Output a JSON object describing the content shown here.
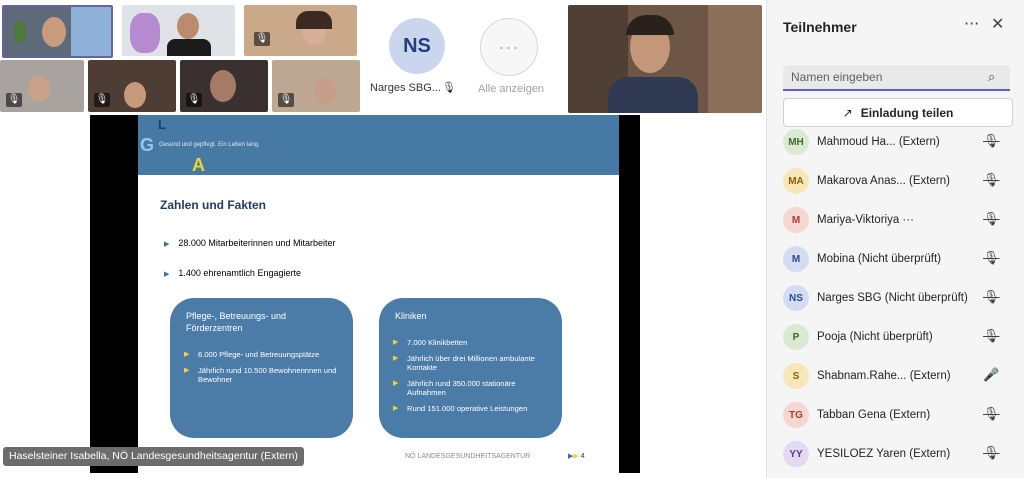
{
  "call": {
    "placeholder_avatar": {
      "initials": "NS",
      "name": "Narges SBG..."
    },
    "show_all_label": "Alle anzeigen",
    "presenter_name": "Haselsteiner Isabella, NÖ Landesgesundheitsagentur (Extern)"
  },
  "slide": {
    "logo_letters": {
      "l": "L",
      "g": "G",
      "a": "A"
    },
    "tagline": "Gesund und gepflegt. Ein Leben lang.",
    "title": "Zahlen und Fakten",
    "bullets": [
      "28.000 Mitarbeiterinnen und Mitarbeiter",
      "1.400 ehrenamtlich Engagierte"
    ],
    "box_left": {
      "title": "Pflege-, Betreuungs- und Förderzentren",
      "items": [
        "6.000 Pflege- und Betreuungsplätze",
        "Jährlich rund 10.500 Bewohnerinnen und Bewohner"
      ]
    },
    "box_right": {
      "title": "Kliniken",
      "items": [
        "7.000 Klinikbetten",
        "Jährlich über drei Millionen ambulante Kontakte",
        "Jährlich rund 350.000 stationäre Aufnahmen",
        "Rund 151.000 operative Leistungen"
      ]
    },
    "footer": "NÖ LANDESGESUNDHEITSAGENTUR",
    "page_number": "4"
  },
  "panel": {
    "title": "Teilnehmer",
    "search_placeholder": "Namen eingeben",
    "invite_label": "Einladung teilen",
    "participants": [
      {
        "initials": "MH",
        "name": "Mahmoud Ha...  (Extern)",
        "bg": "#dbe8d2",
        "fg": "#3f6a2a",
        "mic": "muted"
      },
      {
        "initials": "MA",
        "name": "Makarova Anas... (Extern)",
        "bg": "#f7e7b8",
        "fg": "#8a6100",
        "mic": "muted"
      },
      {
        "initials": "M",
        "name": "Mariya-Viktoriya ···",
        "bg": "#f7d7d2",
        "fg": "#b03a2e",
        "mic": "muted"
      },
      {
        "initials": "M",
        "name": "Mobina (Nicht überprüft)",
        "bg": "#d3dcf2",
        "fg": "#2b4a8b",
        "mic": "muted"
      },
      {
        "initials": "NS",
        "name": "Narges SBG (Nicht überprüft)",
        "bg": "#d3dcf2",
        "fg": "#2b4a8b",
        "mic": "muted"
      },
      {
        "initials": "P",
        "name": "Pooja (Nicht überprüft)",
        "bg": "#dbe8d2",
        "fg": "#3f6a2a",
        "mic": "muted"
      },
      {
        "initials": "S",
        "name": "Shabnam.Rahe... (Extern)",
        "bg": "#f7e7b8",
        "fg": "#8a6100",
        "mic": "on"
      },
      {
        "initials": "TG",
        "name": "Tabban Gena (Extern)",
        "bg": "#f7d7d2",
        "fg": "#b03a2e",
        "mic": "muted"
      },
      {
        "initials": "YY",
        "name": "YESILOEZ Yaren (Extern)",
        "bg": "#e4d9f2",
        "fg": "#5b3a8b",
        "mic": "muted"
      }
    ]
  }
}
